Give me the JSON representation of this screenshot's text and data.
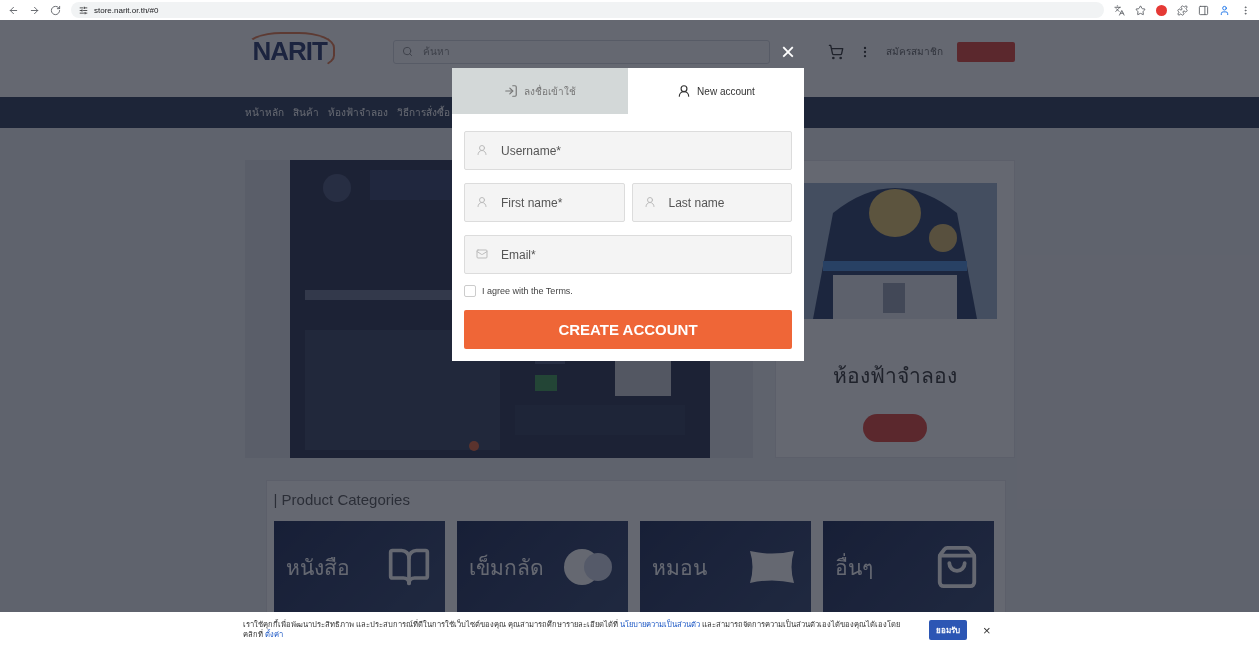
{
  "browser": {
    "url": "store.narit.or.th/#0"
  },
  "header": {
    "logo": "NARIT",
    "search_placeholder": "ค้นหา",
    "register": "สมัครสมาชิก"
  },
  "nav": [
    "หน้าหลัก",
    "สินค้า",
    "ห้องฟ้าจำลอง",
    "วิธีการสั่งซื้อ"
  ],
  "planetarium_card": {
    "title": "ห้องฟ้าจำลอง"
  },
  "categories": {
    "title": "| Product Categories",
    "items": [
      {
        "label": "หนังสือ",
        "kind": "book"
      },
      {
        "label": "เข็มกลัด",
        "kind": "pin"
      },
      {
        "label": "หมอน",
        "kind": "pillow"
      },
      {
        "label": "อื่นๆ",
        "kind": "bag"
      }
    ]
  },
  "modal": {
    "close": "×",
    "tabs": [
      {
        "label": "ลงชื่อเข้าใช้",
        "kind": "login",
        "selected": false
      },
      {
        "label": "New account",
        "kind": "register",
        "selected": true
      }
    ],
    "rows": [
      [
        {
          "placeholder": "Username*",
          "kind": "user"
        }
      ],
      [
        {
          "placeholder": "First name*",
          "kind": "user"
        },
        {
          "placeholder": "Last name",
          "kind": "user"
        }
      ],
      [
        {
          "placeholder": "Email*",
          "kind": "email"
        }
      ]
    ],
    "terms": {
      "label": "I agree with the Terms.",
      "checked": false
    },
    "submit": "CREATE ACCOUNT"
  },
  "cookie": {
    "text_1": "เราใช้คุกกี้เพื่อพัฒนาประสิทธิภาพ และประสบการณ์ที่ดีในการใช้เว็บไซต์ของคุณ คุณสามารถศึกษารายละเอียดได้ที่",
    "link_1": "นโยบายความเป็นส่วนตัว",
    "text_2": "และสามารถจัดการความเป็นส่วนตัวเองได้ของคุณได้เองโดยคลิกที่",
    "link_2": "ตั้งค่า",
    "accept": "ยอมรับ",
    "close": "×"
  }
}
